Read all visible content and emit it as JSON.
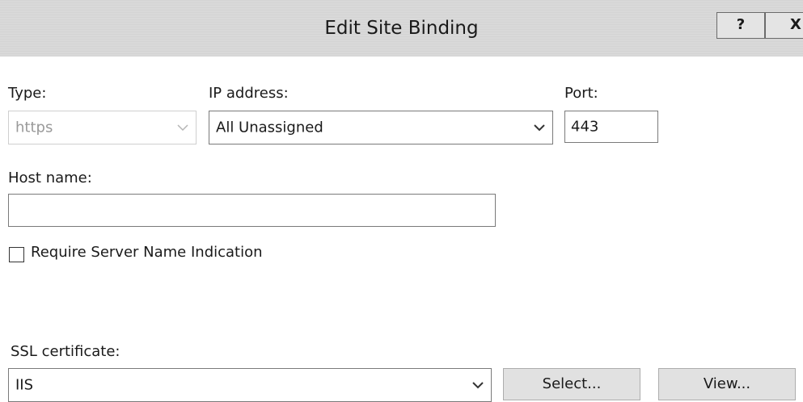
{
  "dialog": {
    "title": "Edit Site Binding",
    "help_label": "?",
    "close_label": "X"
  },
  "type": {
    "label": "Type:",
    "value": "https"
  },
  "ip_address": {
    "label": "IP address:",
    "value": "All Unassigned"
  },
  "port": {
    "label": "Port:",
    "value": "443"
  },
  "host_name": {
    "label": "Host name:",
    "value": ""
  },
  "sni": {
    "label": "Require Server Name Indication",
    "checked": false
  },
  "ssl_certificate": {
    "label": "SSL certificate:",
    "value": "IIS",
    "select_label": "Select...",
    "view_label": "View..."
  }
}
